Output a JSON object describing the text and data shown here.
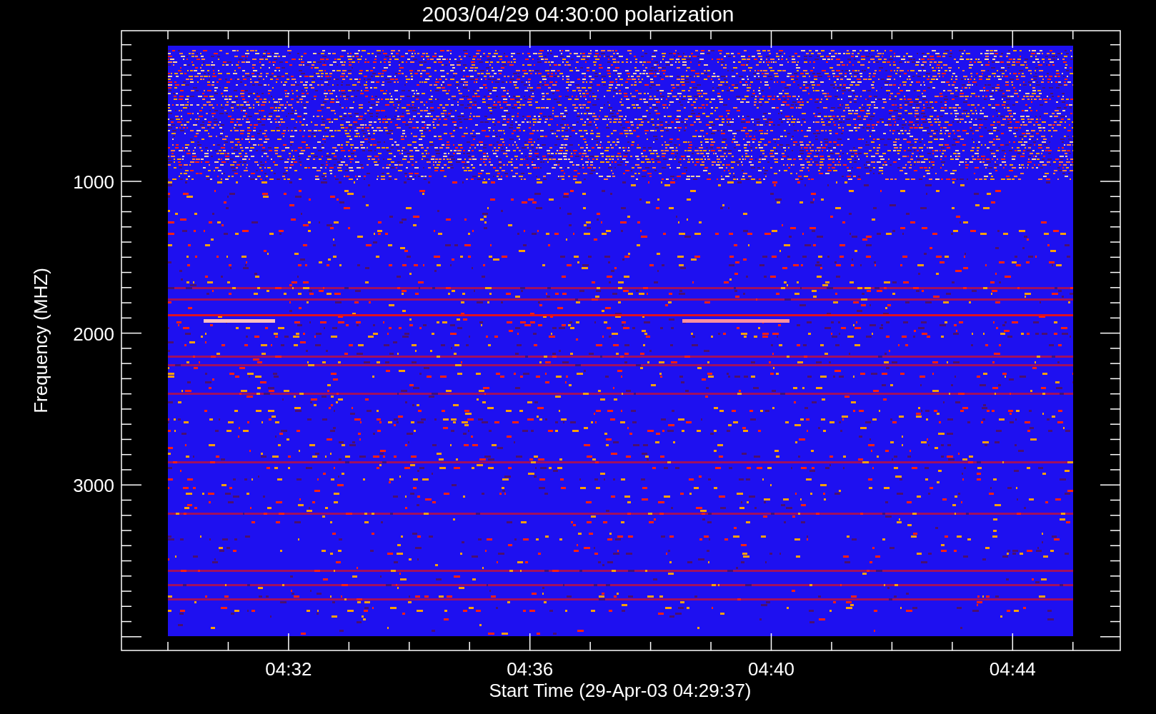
{
  "title": "2003/04/29 04:30:00 polarization",
  "y_axis": {
    "label": "Frequency (MHZ)",
    "ticks": [
      "1000",
      "2000",
      "3000"
    ]
  },
  "x_axis": {
    "label": "Start Time (29-Apr-03 04:29:37)",
    "ticks": [
      "04:32",
      "04:36",
      "04:40",
      "04:44"
    ]
  }
}
